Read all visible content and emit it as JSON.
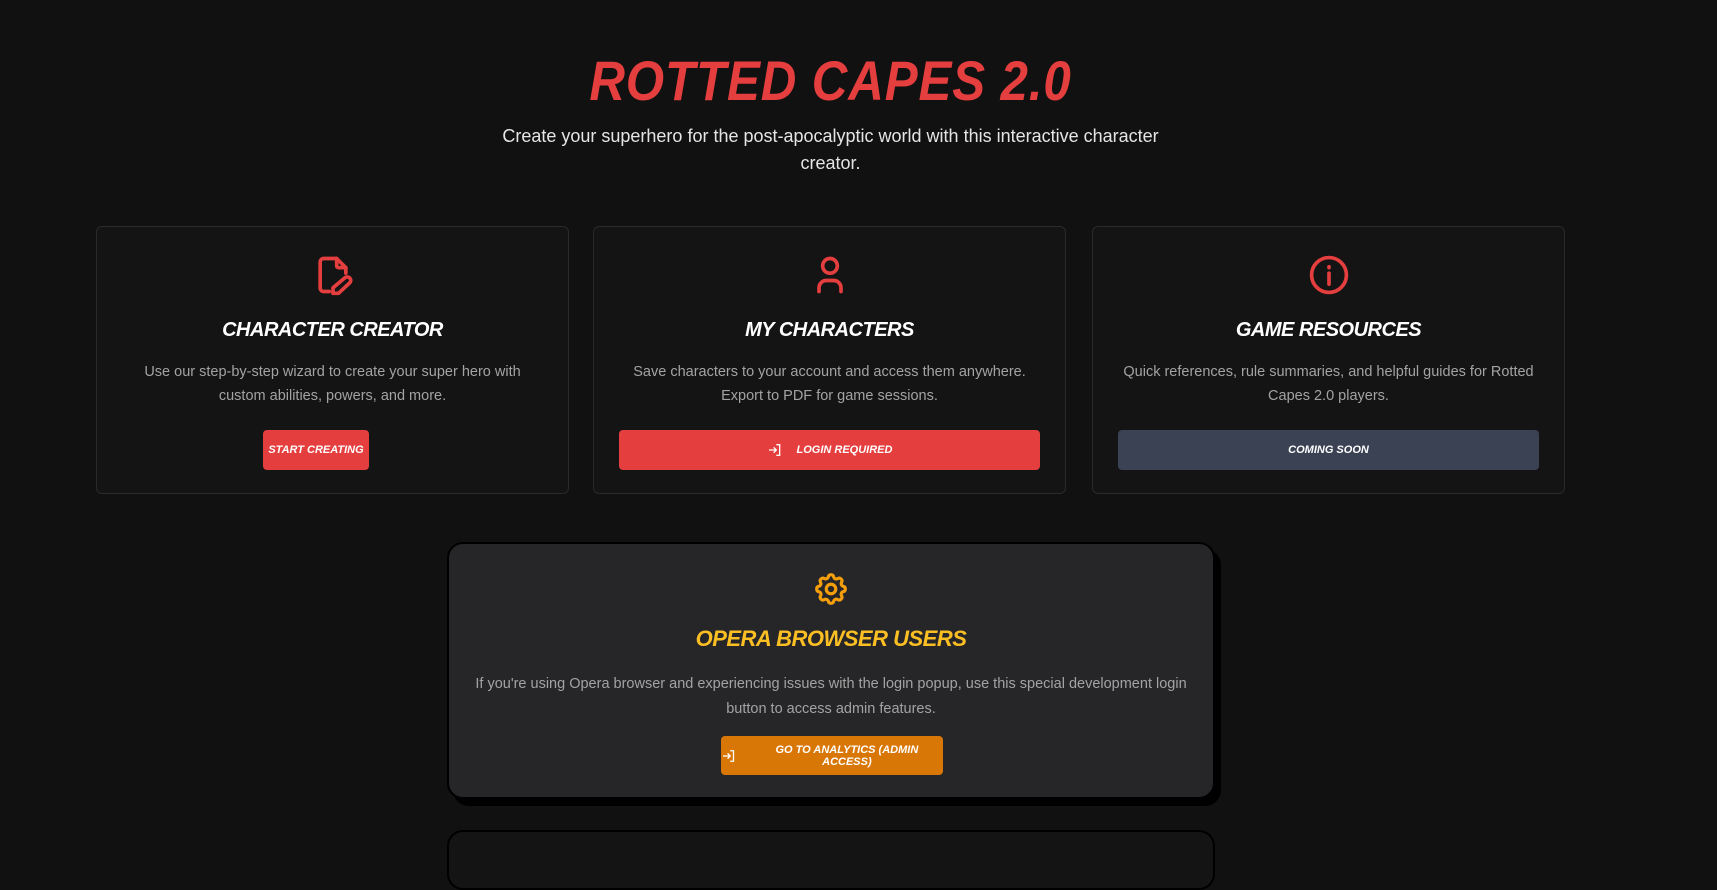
{
  "header": {
    "title": "ROTTED CAPES 2.0",
    "subtitle": "Create your superhero for the post-apocalyptic world with this interactive character creator."
  },
  "cards": [
    {
      "icon": "file-edit-icon",
      "title": "CHARACTER CREATOR",
      "description": "Use our step-by-step wizard to create your super hero with custom abilities, powers, and more.",
      "button": "START CREATING"
    },
    {
      "icon": "user-icon",
      "title": "MY CHARACTERS",
      "description": "Save characters to your account and access them anywhere. Export to PDF for game sessions.",
      "button": "LOGIN REQUIRED"
    },
    {
      "icon": "info-icon",
      "title": "GAME RESOURCES",
      "description": "Quick references, rule summaries, and helpful guides for Rotted Capes 2.0 players.",
      "button": "COMING SOON"
    }
  ],
  "opera": {
    "icon": "gear-icon",
    "title": "OPERA BROWSER USERS",
    "description": "If you're using Opera browser and experiencing issues with the login popup, use this special development login button to access admin features.",
    "button": "GO TO ANALYTICS (ADMIN ACCESS)"
  },
  "colors": {
    "background": "#111111",
    "accent": "#e53e3e",
    "disabled": "#3a4254",
    "warning": "#d97706",
    "warning_text": "#fbbf24"
  }
}
